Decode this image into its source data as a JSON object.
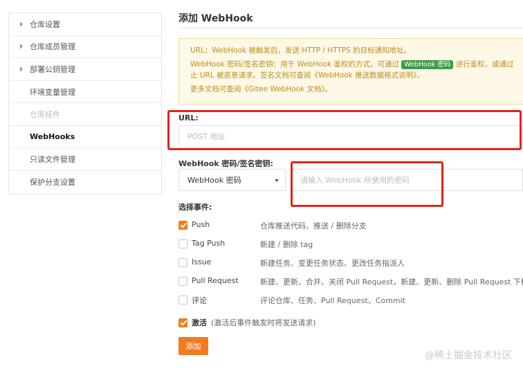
{
  "sidebar": {
    "items": [
      {
        "label": "仓库设置",
        "has_caret": true,
        "state": "normal"
      },
      {
        "label": "仓库成员管理",
        "has_caret": true,
        "state": "normal"
      },
      {
        "label": "部署公钥管理",
        "has_caret": true,
        "state": "normal"
      },
      {
        "label": "环境变量管理",
        "has_caret": false,
        "state": "normal"
      },
      {
        "label": "仓库挂件",
        "has_caret": false,
        "state": "disabled"
      },
      {
        "label": "WebHooks",
        "has_caret": false,
        "state": "active"
      },
      {
        "label": "只读文件管理",
        "has_caret": false,
        "state": "normal"
      },
      {
        "label": "保护分支设置",
        "has_caret": false,
        "state": "normal"
      }
    ]
  },
  "page": {
    "title": "添加 WebHook"
  },
  "notice": {
    "line1": "URL：WebHook 被触发后，发送 HTTP / HTTPS 的目标通知地址。",
    "line2_a": "WebHook 密码/签名密钥：用于 WebHook 鉴权的方式，可通过",
    "line2_badge": "WebHook 密码",
    "line2_b": "进行鉴权，或通过",
    "line3_a": "止 URL 被恶意请求。签名文档可查阅",
    "line3_link": "《WebHook 推送数据格式说明》",
    "line3_b": "。",
    "line4_a": "更多文档可查阅",
    "line4_link": "《Gitee WebHook 文档》",
    "line4_b": "。"
  },
  "form": {
    "url_label": "URL:",
    "url_placeholder": "POST 地址",
    "secret_label": "WebHook 密码/签名密钥:",
    "secret_type_selected": "WebHook 密码",
    "secret_placeholder": "请输入 WebHook 所使用的密码",
    "events_label": "选择事件:",
    "events": [
      {
        "name": "Push",
        "desc": "仓库推送代码、推送 / 删除分支",
        "checked": true
      },
      {
        "name": "Tag Push",
        "desc": "新建 / 删除 tag",
        "checked": false
      },
      {
        "name": "Issue",
        "desc": "新建任务、变更任务状态、更改任务指派人",
        "checked": false
      },
      {
        "name": "Pull Request",
        "desc": "新建、更新、合并、关闭 Pull Request，新建、更新、删除 Pull Request 下标",
        "checked": false
      },
      {
        "name": "评论",
        "desc": "评论仓库、任务、Pull Request、Commit",
        "checked": false
      }
    ],
    "activate_label": "激活",
    "activate_hint": "(激活后事件触发时将发送请求)",
    "activate_checked": true,
    "submit_label": "添加"
  },
  "watermark": "@稀土掘金技术社区",
  "colors": {
    "accent": "#f37b1d",
    "badge": "#3b9c47",
    "notice_bg": "#fdf9e6",
    "notice_text": "#c08a1e",
    "highlight": "#e2231a"
  }
}
